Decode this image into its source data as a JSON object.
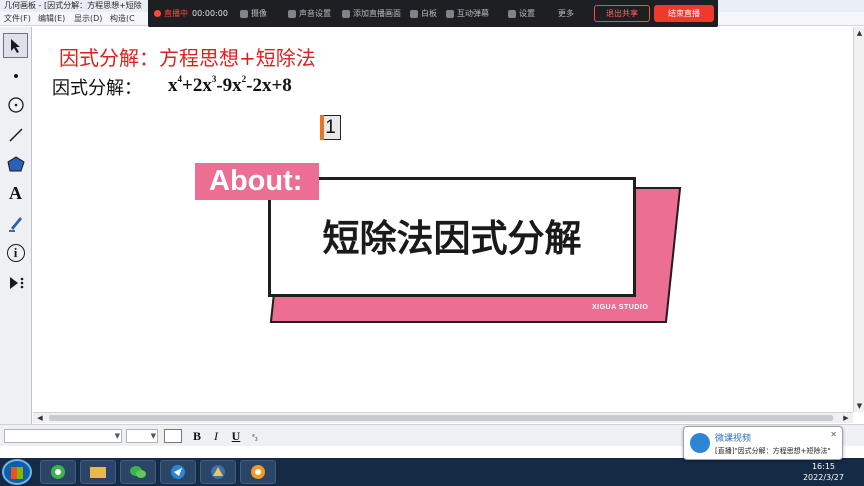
{
  "window": {
    "title": "几何画板 - [因式分解：方程思想+短除"
  },
  "menu": [
    "文件(F)",
    "编辑(E)",
    "显示(D)",
    "构造(C"
  ],
  "live_toolbar": {
    "live": "直播中",
    "time": "00:00:00",
    "camera": "摄像",
    "mic": "声音设置",
    "add_screen": "添加直播画面",
    "whiteboard": "白板",
    "interact": "互动弹幕",
    "settings": "设置",
    "more": "更多",
    "share": "退出共享",
    "end": "结束直播"
  },
  "tools": [
    {
      "name": "arrow-select-icon"
    },
    {
      "name": "point-icon"
    },
    {
      "name": "compass-circle-icon"
    },
    {
      "name": "line-icon"
    },
    {
      "name": "polygon-icon"
    },
    {
      "name": "text-icon",
      "glyph": "A"
    },
    {
      "name": "marker-icon"
    },
    {
      "name": "information-icon",
      "glyph": "i"
    },
    {
      "name": "custom-tool-icon"
    }
  ],
  "canvas": {
    "heading": "因式分解：方程思想+短除法",
    "problem_label": "因式分解：",
    "expr": {
      "t1": "x",
      "e1": "4",
      "t2": "+2x",
      "e2": "3",
      "t3": "-9x",
      "e3": "2",
      "t4": "-2x+8"
    },
    "page_num": "1"
  },
  "sticker": {
    "tab": "About:",
    "title": "短除法因式分解",
    "brand": "XIGUA STUDIO",
    "color": "#ec6e93"
  },
  "format_bar": {
    "bold": "B",
    "italic": "I",
    "underline": "U",
    "special": "ᵃ₃"
  },
  "notification": {
    "app": "微课视频",
    "message": "[直播]\"因式分解：方程思想+短除法\""
  },
  "clock": {
    "time": "16:15",
    "date": "2022/3/27"
  }
}
